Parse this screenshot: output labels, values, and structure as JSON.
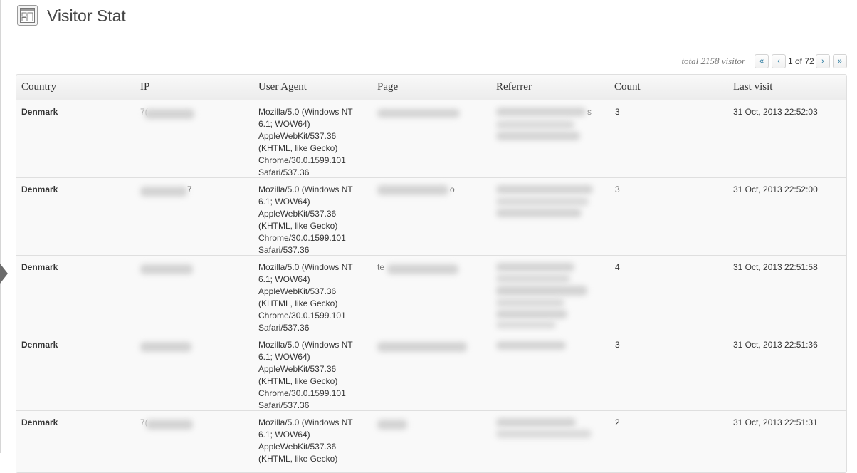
{
  "page": {
    "title": "Visitor Stat",
    "icon": "table-layout-icon"
  },
  "pagination": {
    "total_text": "total 2158 visitor",
    "first": "«",
    "prev": "‹",
    "page_text": "1 of 72",
    "next": "›",
    "last": "»"
  },
  "table": {
    "headers": [
      "Country",
      "IP",
      "User Agent",
      "Page",
      "Referrer",
      "Count",
      "Last visit"
    ],
    "rows": [
      {
        "country": "Denmark",
        "ip_fragment": "7(",
        "user_agent": [
          "Mozilla/5.0 (Windows NT",
          "6.1; WOW64)",
          "AppleWebKit/537.36",
          "(KHTML, like Gecko)",
          "Chrome/30.0.1599.101",
          "Safari/537.36"
        ],
        "page_fragment": "",
        "referrer_fragment": "s",
        "count": "3",
        "last_visit": "31 Oct, 2013 22:52:03"
      },
      {
        "country": "Denmark",
        "ip_fragment": "7",
        "user_agent": [
          "Mozilla/5.0 (Windows NT",
          "6.1; WOW64)",
          "AppleWebKit/537.36",
          "(KHTML, like Gecko)",
          "Chrome/30.0.1599.101",
          "Safari/537.36"
        ],
        "page_fragment": "o",
        "referrer_fragment": "",
        "count": "3",
        "last_visit": "31 Oct, 2013 22:52:00"
      },
      {
        "country": "Denmark",
        "ip_fragment": "",
        "user_agent": [
          "Mozilla/5.0 (Windows NT",
          "6.1; WOW64)",
          "AppleWebKit/537.36",
          "(KHTML, like Gecko)",
          "Chrome/30.0.1599.101",
          "Safari/537.36"
        ],
        "page_fragment": "te",
        "referrer_fragment": "",
        "count": "4",
        "last_visit": "31 Oct, 2013 22:51:58"
      },
      {
        "country": "Denmark",
        "ip_fragment": "",
        "user_agent": [
          "Mozilla/5.0 (Windows NT",
          "6.1; WOW64)",
          "AppleWebKit/537.36",
          "(KHTML, like Gecko)",
          "Chrome/30.0.1599.101",
          "Safari/537.36"
        ],
        "page_fragment": "",
        "referrer_fragment": "",
        "count": "3",
        "last_visit": "31 Oct, 2013 22:51:36"
      },
      {
        "country": "Denmark",
        "ip_fragment": "7(",
        "user_agent": [
          "Mozilla/5.0 (Windows NT",
          "6.1; WOW64)",
          "AppleWebKit/537.36",
          "(KHTML, like Gecko)"
        ],
        "page_fragment": "",
        "referrer_fragment": "",
        "count": "2",
        "last_visit": "31 Oct, 2013 22:51:31"
      }
    ]
  },
  "colors": {
    "accent": "#21759b",
    "header_bg": "#ececec",
    "row_bg": "#f9f9f9",
    "border": "#dfdfdf"
  }
}
